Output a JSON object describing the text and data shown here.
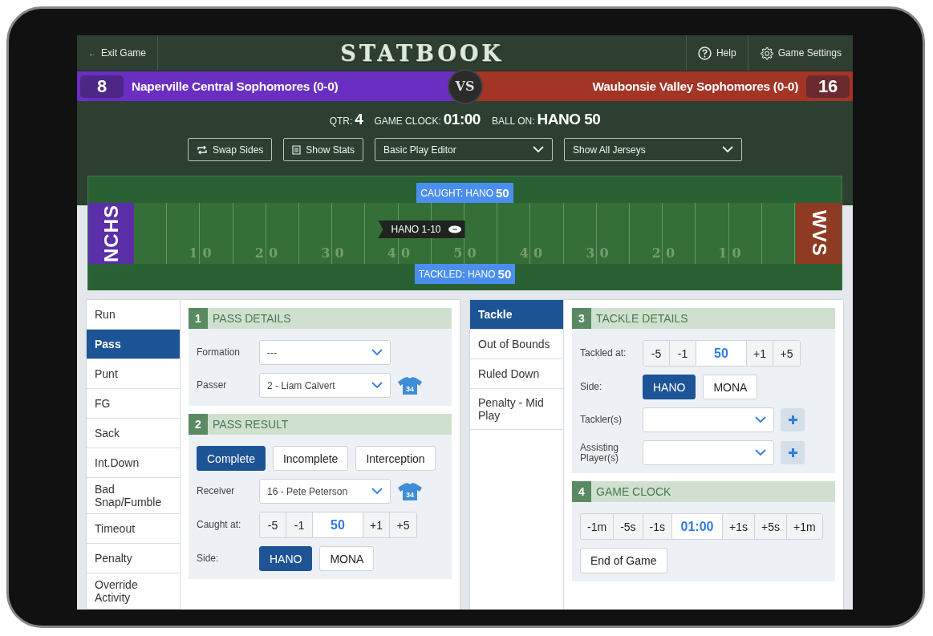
{
  "header": {
    "exit_arrow": "←",
    "exit": "Exit Game",
    "title": "STATBOOK",
    "help": "Help",
    "settings": "Game Settings"
  },
  "teams": [
    {
      "score": "8",
      "name": "Naperville Central Sophomores (0-0)",
      "color": "#6a2fc2"
    },
    {
      "score": "16",
      "name": "Waubonsie Valley Sophomores (0-0)",
      "color": "#a33426"
    }
  ],
  "vs": "VS",
  "game_info": [
    {
      "label": "QTR:",
      "value": "4"
    },
    {
      "label": "GAME CLOCK:",
      "value": "01:00"
    },
    {
      "label": "BALL ON:",
      "value": "HANO 50"
    }
  ],
  "toolbar": {
    "buttons": [
      {
        "kind": "swap",
        "label": "Swap Sides"
      },
      {
        "kind": "stats",
        "label": "Show Stats"
      }
    ],
    "selects": [
      "Basic Play Editor",
      "Show All Jerseys"
    ]
  },
  "field": {
    "end_zones": [
      {
        "label": "NCHS",
        "color": "#5b2fa8"
      },
      {
        "label": "WVS",
        "color": "#8f3a22"
      }
    ],
    "yard_labels": [
      "10",
      "20",
      "30",
      "40",
      "50",
      "40",
      "30",
      "20",
      "10"
    ],
    "caught": "CAUGHT: HANO **50**",
    "tackled": "TACKLED: HANO **50**",
    "down": "HANO 1-10"
  },
  "cards": [
    {
      "menu": [
        {
          "label": "Run",
          "selected": false
        },
        {
          "label": "Pass",
          "selected": true
        },
        {
          "label": "Punt",
          "selected": false
        },
        {
          "label": "FG",
          "selected": false
        },
        {
          "label": "Sack",
          "selected": false
        },
        {
          "label": "Int.Down",
          "selected": false
        },
        {
          "label": "Bad Snap/Fumble",
          "selected": false
        },
        {
          "label": "Timeout",
          "selected": false
        },
        {
          "label": "Penalty",
          "selected": false
        },
        {
          "label": "Override Activity",
          "selected": false
        }
      ],
      "sections": [
        {
          "number": "1",
          "title": "PASS DETAILS",
          "rows": [
            {
              "kind": "select",
              "label": "Formation",
              "value": "---"
            },
            {
              "kind": "select",
              "label": "Passer",
              "value": "2 - Liam Calvert",
              "jersey": "34"
            }
          ]
        },
        {
          "number": "2",
          "title": "PASS RESULT",
          "rows": [
            {
              "kind": "choices",
              "options": [
                {
                  "label": "Complete",
                  "selected": true
                },
                {
                  "label": "Incomplete",
                  "selected": false
                },
                {
                  "label": "Interception",
                  "selected": false
                }
              ]
            },
            {
              "kind": "select",
              "label": "Receiver",
              "value": "16 - Pete Peterson",
              "jersey": "34"
            },
            {
              "kind": "stepper",
              "label": "Caught at:",
              "before": [
                "-5",
                "-1"
              ],
              "value": "50",
              "after": [
                "+1",
                "+5"
              ]
            },
            {
              "kind": "choices",
              "label": "Side:",
              "options": [
                {
                  "label": "HANO",
                  "selected": true
                },
                {
                  "label": "MONA",
                  "selected": false
                }
              ]
            }
          ]
        }
      ]
    },
    {
      "menu": [
        {
          "label": "Tackle",
          "selected": true
        },
        {
          "label": "Out of Bounds",
          "selected": false
        },
        {
          "label": "Ruled Down",
          "selected": false
        },
        {
          "label": "Penalty - Mid Play",
          "selected": false
        }
      ],
      "sections": [
        {
          "number": "3",
          "title": "TACKLE DETAILS",
          "rows": [
            {
              "kind": "stepper",
              "label": "Tackled at:",
              "before": [
                "-5",
                "-1"
              ],
              "value": "50",
              "after": [
                "+1",
                "+5"
              ]
            },
            {
              "kind": "choices",
              "label": "Side:",
              "options": [
                {
                  "label": "HANO",
                  "selected": true
                },
                {
                  "label": "MONA",
                  "selected": false
                }
              ]
            },
            {
              "kind": "add_select",
              "label": "Tackler(s)"
            },
            {
              "kind": "add_select",
              "label": "Assisting Player(s)"
            }
          ]
        },
        {
          "number": "4",
          "title": "GAME CLOCK",
          "rows": [
            {
              "kind": "stepper",
              "before": [
                "-1m",
                "-5s",
                "-1s"
              ],
              "value": "01:00",
              "after": [
                "+1s",
                "+5s",
                "+1m"
              ]
            },
            {
              "kind": "button",
              "text": "End of Game"
            }
          ]
        }
      ]
    }
  ]
}
